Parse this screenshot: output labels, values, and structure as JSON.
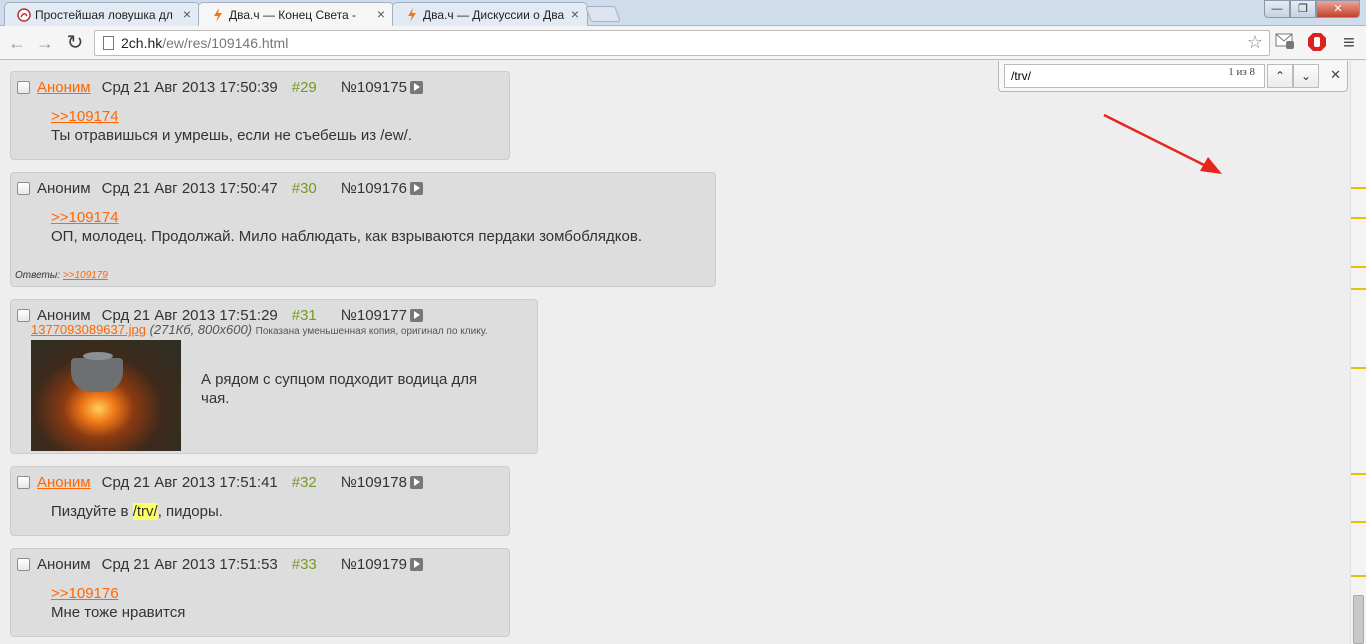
{
  "tabs": [
    {
      "title": "Простейшая ловушка дл"
    },
    {
      "title": "Два.ч — Конец Света -"
    },
    {
      "title": "Два.ч — Дискуссии о Два"
    }
  ],
  "window": {
    "minimize": "—",
    "maximize": "❐",
    "close": "✕"
  },
  "toolbar": {
    "back": "←",
    "forward": "→",
    "reload": "↻",
    "url_domain": "2ch.hk",
    "url_path": "/ew/res/109146.html",
    "star": "☆",
    "menu": "≡"
  },
  "find": {
    "query": "/trv/",
    "count": "1 из 8",
    "prev": "⌃",
    "next": "⌄",
    "close": "✕"
  },
  "posts": [
    {
      "name": "Аноним",
      "date": "Срд 21 Авг 2013 17:50:39",
      "num": "#29",
      "id": "№109175",
      "reply_link": ">>109174",
      "text": "Ты отравишься и умрешь, если не съебешь из /ew/."
    },
    {
      "name": "Аноним",
      "date": "Срд 21 Авг 2013 17:50:47",
      "num": "#30",
      "id": "№109176",
      "reply_link": ">>109174",
      "text": "ОП, молодец. Продолжай. Мило наблюдать, как взрываются пердаки зомбоблядков.",
      "replies_label": "Ответы:",
      "replies_link": ">>109179"
    },
    {
      "name": "Аноним",
      "date": "Срд 21 Авг 2013 17:51:29",
      "num": "#31",
      "id": "№109177",
      "file_name": "1377093089637.jpg",
      "file_meta": "(271Кб, 800x600)",
      "file_note": "Показана уменьшенная копия, оригинал по клику.",
      "text_line1": "А рядом с супцом подходит водица для",
      "text_line2": "чая."
    },
    {
      "name": "Аноним",
      "date": "Срд 21 Авг 2013 17:51:41",
      "num": "#32",
      "id": "№109178",
      "text_before": "Пиздуйте в ",
      "text_hl": "/trv/",
      "text_after": ", пидоры."
    },
    {
      "name": "Аноним",
      "date": "Срд 21 Авг 2013 17:51:53",
      "num": "#33",
      "id": "№109179",
      "reply_link": ">>109176",
      "text": "Мне тоже нравится"
    }
  ],
  "colors": {
    "accent": "#ff6600",
    "post_number": "#789922",
    "highlight": "#ffff66",
    "annotation_arrow": "#e8251b"
  }
}
